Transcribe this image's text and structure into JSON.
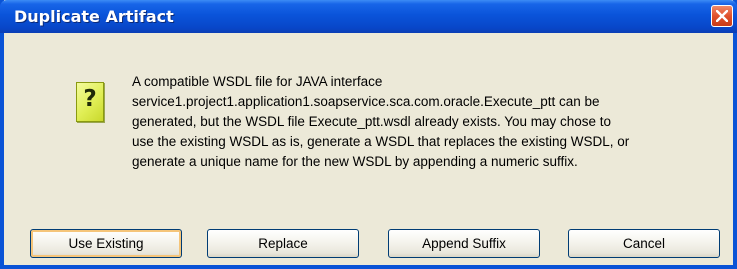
{
  "window": {
    "title": "Duplicate Artifact",
    "close_icon": "close-icon"
  },
  "dialog": {
    "icon": "question-icon",
    "icon_glyph": "?",
    "message_lines": [
      "A compatible WSDL file for JAVA interface",
      "service1.project1.application1.soapservice.sca.com.oracle.Execute_ptt can be",
      "generated, but the WSDL file Execute_ptt.wsdl already exists. You may chose to",
      "use the existing WSDL as is, generate a WSDL that replaces the existing WSDL, or",
      "generate a unique name for the new WSDL by appending a numeric suffix."
    ]
  },
  "buttons": {
    "use_existing": "Use Existing",
    "replace": "Replace",
    "append_suffix": "Append Suffix",
    "cancel": "Cancel"
  },
  "colors": {
    "titlebar": "#0a54da",
    "dialog_bg": "#ece9d8",
    "close_button": "#e0512c",
    "icon_fill": "#e0ee55"
  }
}
